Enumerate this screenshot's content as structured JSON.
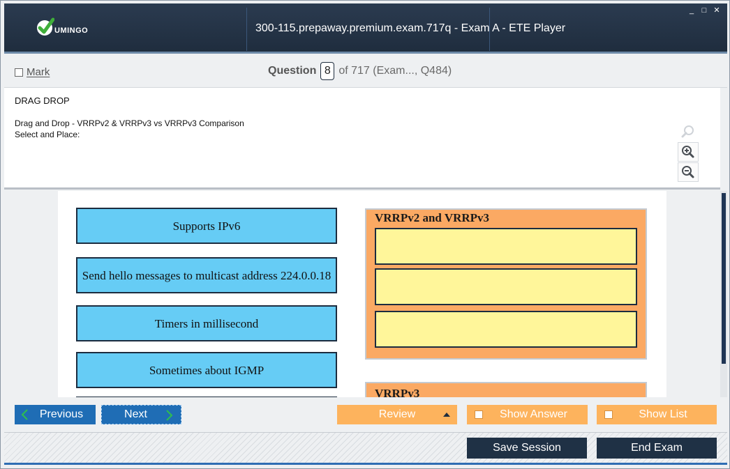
{
  "window": {
    "title": "300-115.prepaway.premium.exam.717q - Exam A - ETE Player",
    "logo_text": "UMINGO",
    "controls": [
      "_",
      "□",
      "✕"
    ]
  },
  "header": {
    "mark_label": "Mark",
    "question_label": "Question",
    "question_number": "8",
    "question_suffix": "of 717 (Exam..., Q484)"
  },
  "question": {
    "type": "DRAG DROP",
    "line1": "Drag and Drop - VRRPv2 & VRRPv3 vs VRRPv3 Comparison",
    "line2": "Select and Place:"
  },
  "zoom_tools": [
    "search-icon",
    "zoom-in-icon",
    "zoom-out-icon"
  ],
  "exhibit": {
    "source_items": [
      "Supports IPv6",
      "Send hello messages to multicast address 224.0.0.18",
      "Timers in millisecond",
      "Sometimes about IGMP"
    ],
    "group_1_title": "VRRPv2 and VRRPv3",
    "group_2_title": "VRRPv3",
    "colors": {
      "source": "#66ccf5",
      "group": "#fba963",
      "slot": "#fff69a"
    }
  },
  "nav": {
    "previous": "Previous",
    "next": "Next",
    "review": "Review",
    "show_answer": "Show Answer",
    "show_list": "Show List",
    "save_session": "Save Session",
    "end_exam": "End Exam"
  }
}
